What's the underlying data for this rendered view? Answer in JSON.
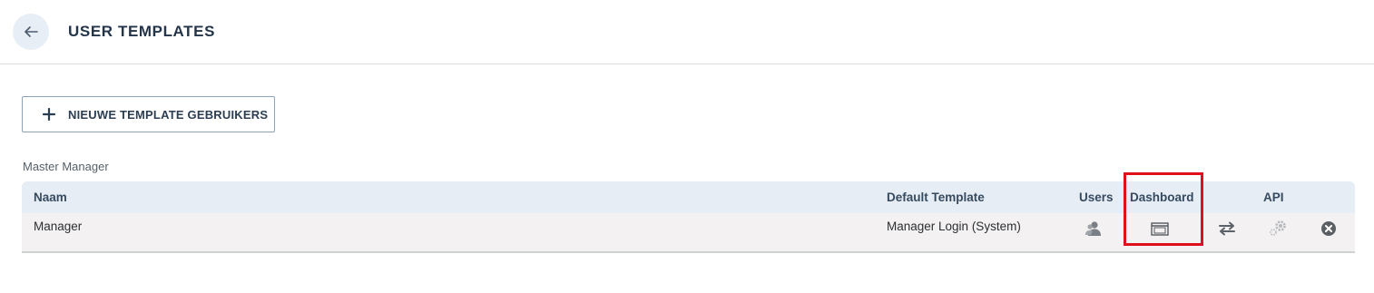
{
  "header": {
    "title": "USER TEMPLATES",
    "back_icon": "arrow-left-icon"
  },
  "toolbar": {
    "new_button_label": "NIEUWE TEMPLATE GEBRUIKERS",
    "new_button_icon": "plus-icon"
  },
  "group": {
    "label": "Master Manager"
  },
  "table": {
    "columns": {
      "name": "Naam",
      "default_template": "Default Template",
      "users": "Users",
      "dashboard": "Dashboard",
      "api": "API"
    },
    "rows": [
      {
        "name": "Manager",
        "default_template": "Manager Login (System)",
        "icons": [
          "users-icon",
          "dashboard-window-icon",
          "swap-arrows-icon",
          "api-gear-icon",
          "delete-circle-icon"
        ]
      }
    ]
  },
  "colors": {
    "highlight": "#e0101a",
    "header_bg": "#e6edf5",
    "row_bg": "#f3f1f1"
  }
}
